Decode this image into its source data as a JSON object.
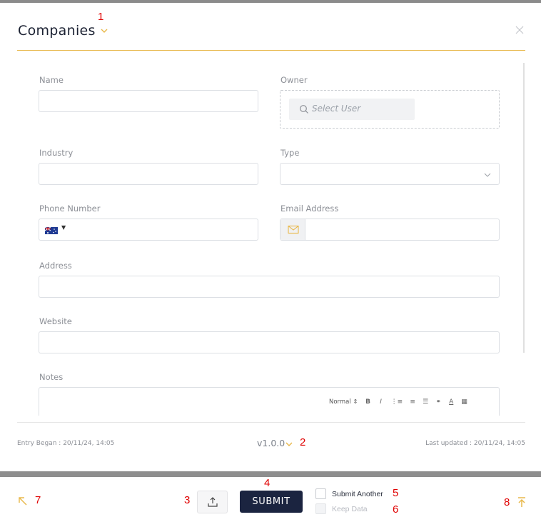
{
  "header": {
    "title": "Companies",
    "close_icon": "close-icon",
    "title_dropdown_icon": "chevron-down-icon"
  },
  "form": {
    "name": {
      "label": "Name",
      "value": ""
    },
    "owner": {
      "label": "Owner",
      "placeholder": "Select User"
    },
    "industry": {
      "label": "Industry",
      "value": ""
    },
    "type": {
      "label": "Type",
      "value": ""
    },
    "phone": {
      "label": "Phone Number",
      "country_flag": "AU",
      "value": ""
    },
    "email": {
      "label": "Email Address",
      "value": ""
    },
    "address": {
      "label": "Address",
      "value": ""
    },
    "website": {
      "label": "Website",
      "value": ""
    },
    "notes": {
      "label": "Notes",
      "toolbar": {
        "format_select": "Normal",
        "format_chevron": "⇕"
      }
    }
  },
  "footer": {
    "entry_began": "Entry Began : 20/11/24, 14:05",
    "version": "v1.0.0",
    "last_updated": "Last updated : 20/11/24, 14:05"
  },
  "actions": {
    "submit_label": "SUBMIT",
    "submit_another_label": "Submit Another",
    "keep_data_label": "Keep Data"
  },
  "annotations": [
    "1",
    "2",
    "3",
    "4",
    "5",
    "6",
    "7",
    "8"
  ],
  "colors": {
    "accent": "#e8b84a",
    "submit_bg": "#1b2440",
    "annotation": "#e00000"
  }
}
